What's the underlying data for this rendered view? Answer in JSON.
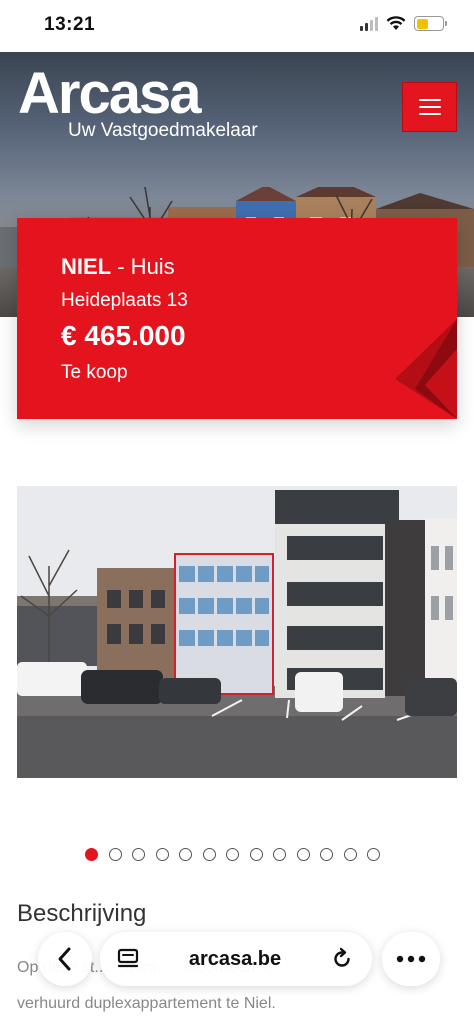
{
  "status_bar": {
    "time": "13:21",
    "battery_level": 0.45,
    "battery_color": "#f2c200"
  },
  "header": {
    "logo_text": "Arcasa",
    "tagline": "Uw Vastgoedmakelaar",
    "menu_icon": "hamburger-icon",
    "brand_color": "#e3151e"
  },
  "listing": {
    "city": "NIEL",
    "type_separator": " - Huis",
    "address": "Heideplaats 13",
    "price": "€ 465.000",
    "status": "Te koop"
  },
  "gallery": {
    "total_images": 13,
    "active_index": 0
  },
  "description": {
    "title": "Beschrijving",
    "text_line1": "Op deze st... ...dom... ...doorheen s...",
    "text_line2": "verhuurd duplexappartement te Niel."
  },
  "browser": {
    "url": "arcasa.be",
    "back_icon": "chevron-left-icon",
    "tabs_icon": "tabs-icon",
    "reload_icon": "reload-icon",
    "more_icon": "more-dots-icon"
  }
}
